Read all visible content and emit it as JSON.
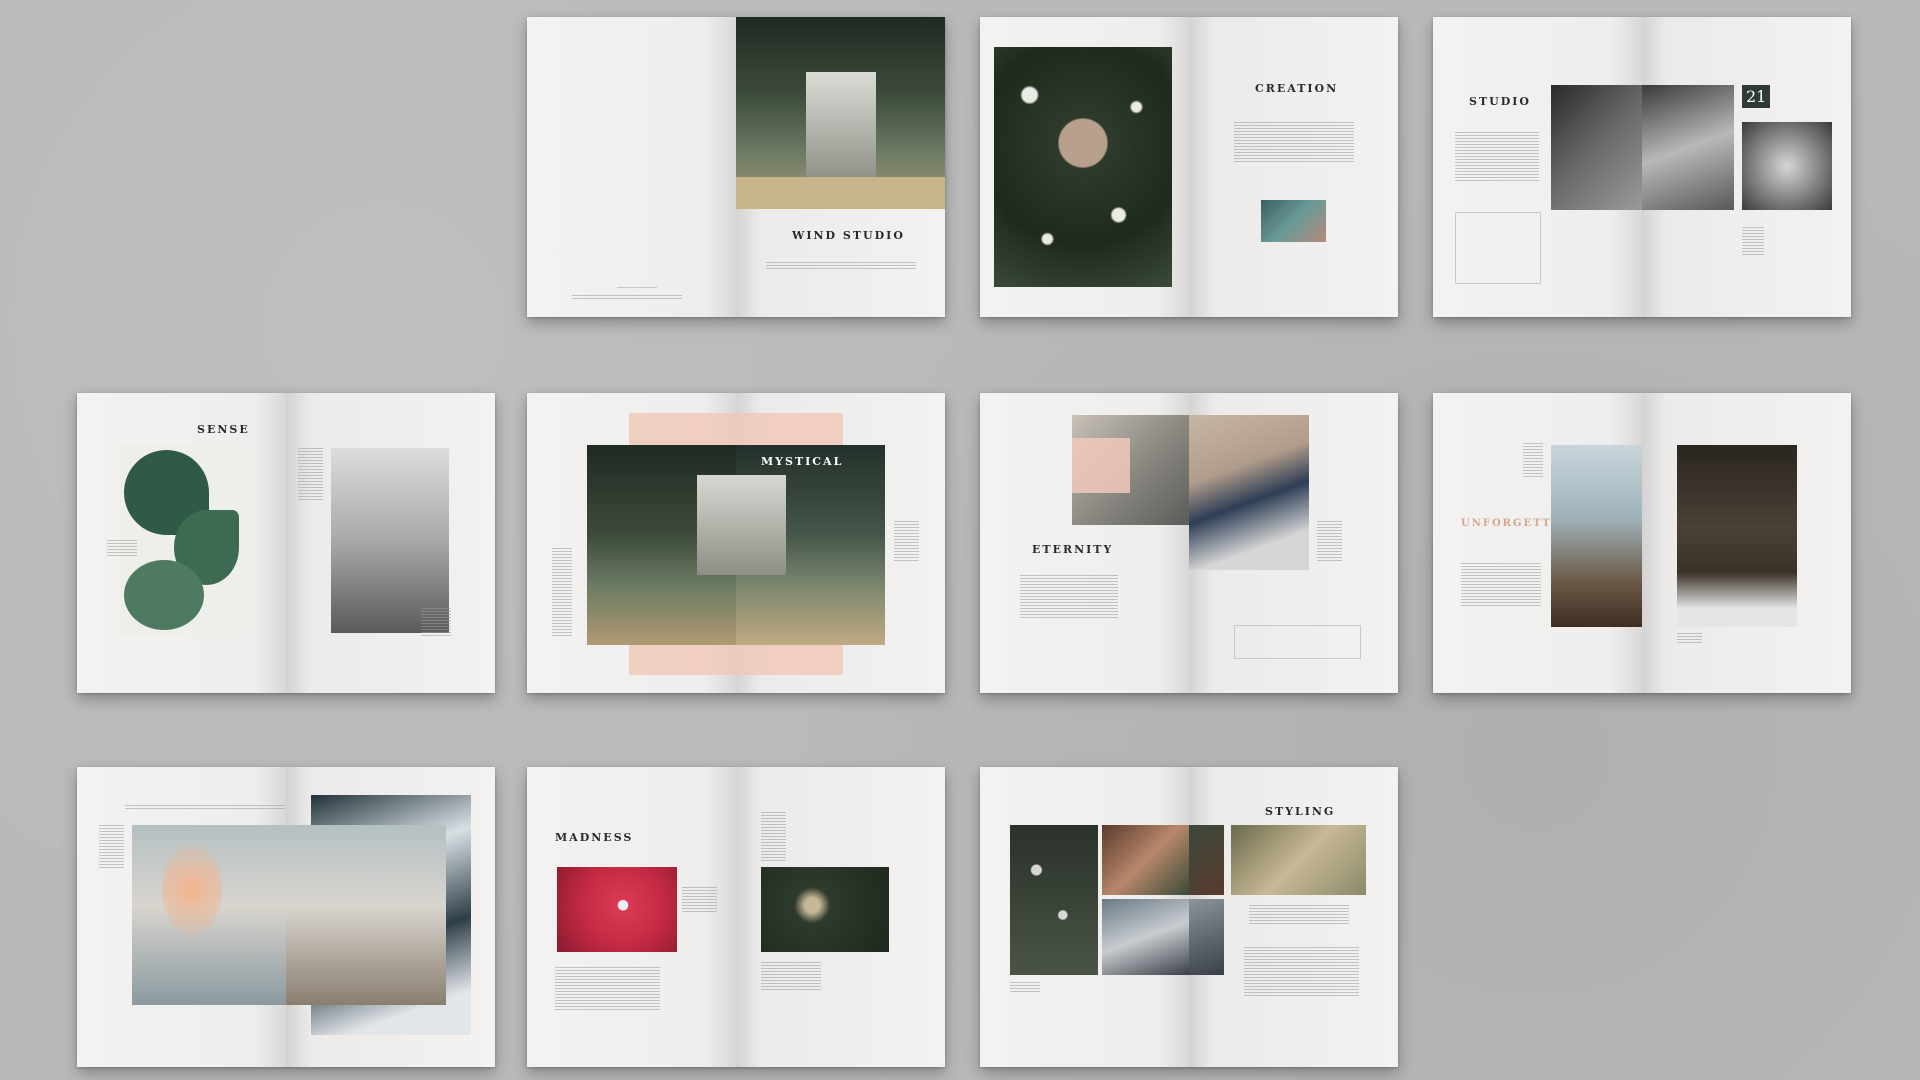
{
  "spreads": {
    "s1": {
      "title": "WIND STUDIO"
    },
    "s2": {
      "title": "CREATION"
    },
    "s3": {
      "title": "STUDIO",
      "number": "21"
    },
    "s4": {
      "title": "SENSE"
    },
    "s5": {
      "title": "MYSTICAL"
    },
    "s6": {
      "title": "ETERNITY"
    },
    "s7": {
      "title": "UNFORGETTABLE"
    },
    "s8": {
      "title": ""
    },
    "s9": {
      "title": "MADNESS"
    },
    "s10": {
      "title": "STYLING"
    }
  },
  "colors": {
    "background": "#b9b9b9",
    "page": "#f1f0ee",
    "accent_pink": "#f0c9bb",
    "title_text": "#2a2a2a"
  }
}
